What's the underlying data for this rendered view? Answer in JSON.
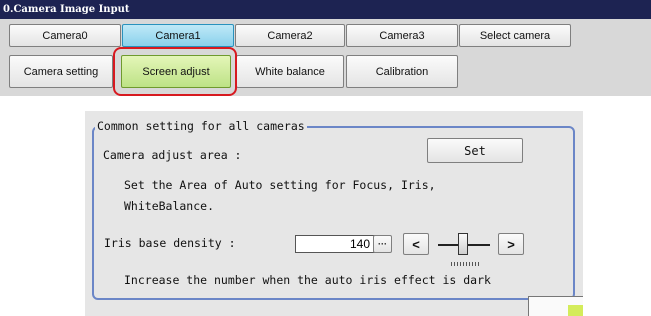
{
  "window": {
    "title": "0.Camera Image Input"
  },
  "camera_tabs": [
    "Camera0",
    "Camera1",
    "Camera2",
    "Camera3",
    "Select camera"
  ],
  "active_camera_tab": "Camera1",
  "sub_tabs": [
    "Camera setting",
    "Screen adjust",
    "White balance",
    "Calibration"
  ],
  "active_sub_tab": "Screen adjust",
  "group": {
    "title": "Common setting for all cameras",
    "adjust_area_label": "Camera adjust area :",
    "set_button": "Set",
    "description_line1": "Set the Area of Auto setting for Focus, Iris,",
    "description_line2": "WhiteBalance.",
    "iris_label": "Iris base density :",
    "iris_value": "140",
    "iris_fraction": 0.45,
    "more_button": "···",
    "dec_button": "<",
    "inc_button": ">",
    "hint": "Increase the number when the auto iris effect is dark"
  },
  "colors": {
    "title_bar": "#1d2352",
    "active_tab": "#8ad1ec",
    "active_subtab": "#bde286",
    "highlight_ring": "#d71920",
    "group_border": "#6b86c7"
  }
}
